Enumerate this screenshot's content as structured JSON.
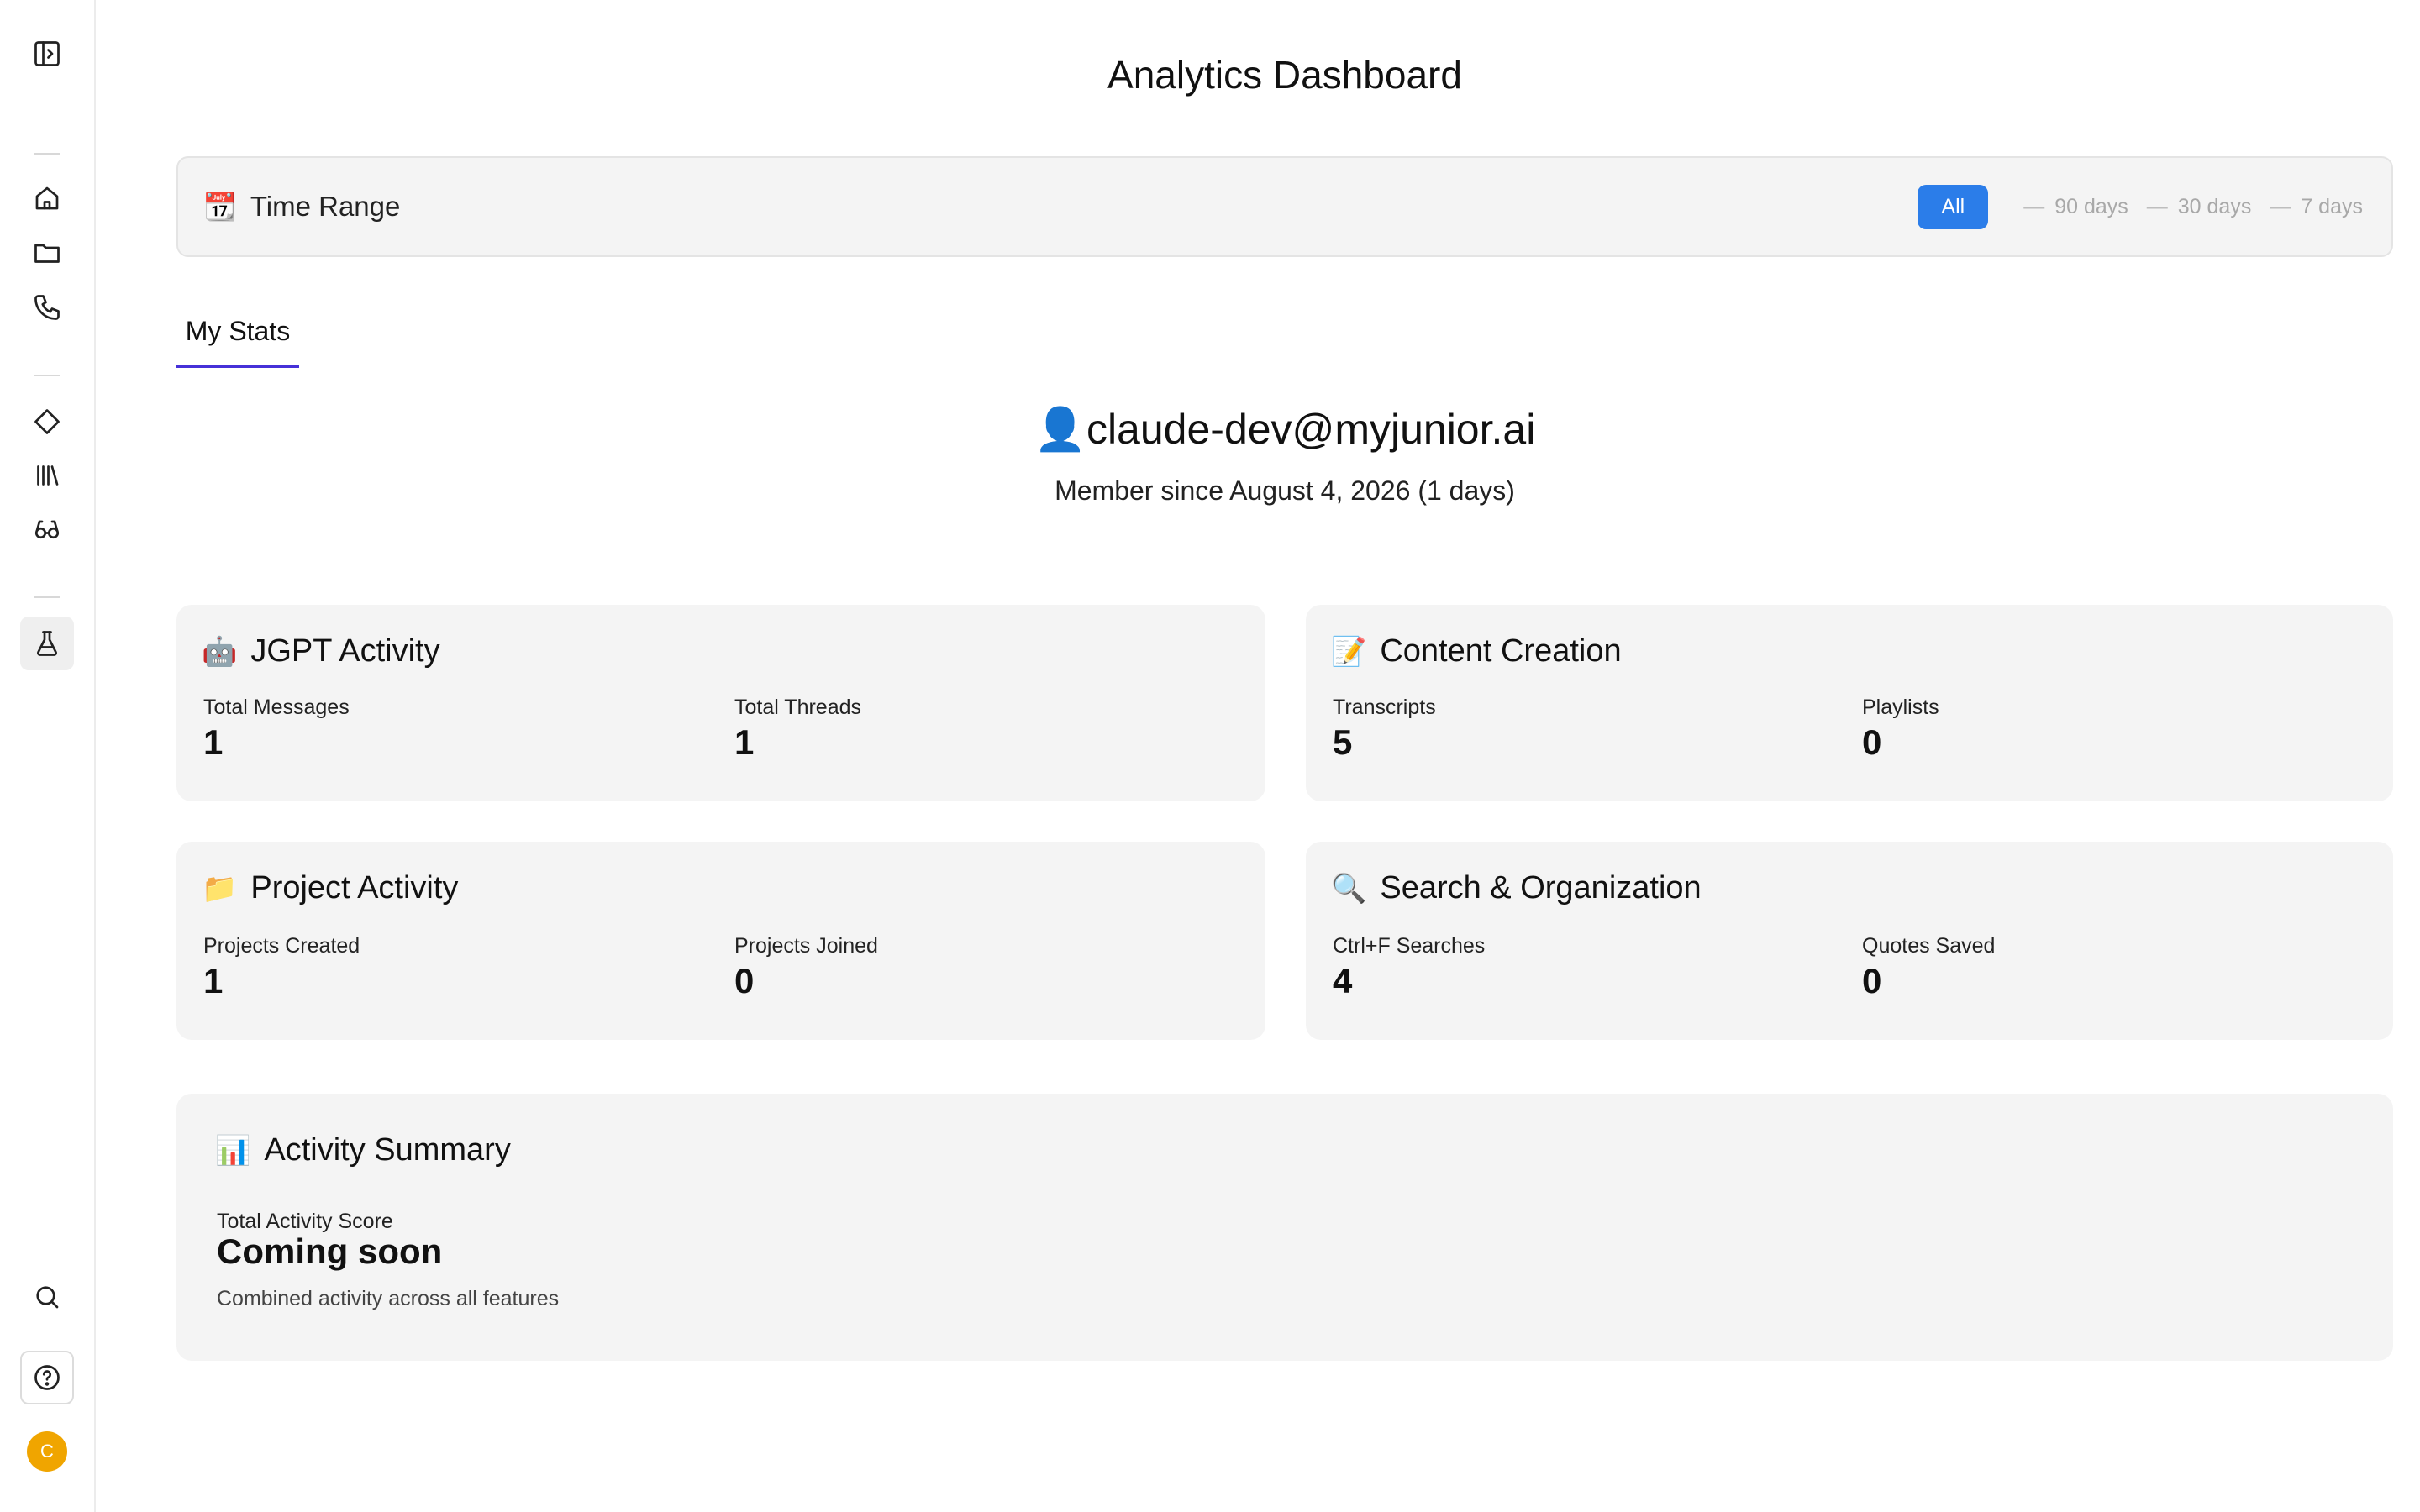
{
  "sidebar": {
    "items": [
      {
        "name": "toggle-sidebar-icon"
      },
      {
        "name": "home-icon"
      },
      {
        "name": "folder-icon"
      },
      {
        "name": "phone-icon"
      },
      {
        "name": "diamond-icon"
      },
      {
        "name": "library-icon"
      },
      {
        "name": "glasses-icon"
      },
      {
        "name": "flask-icon",
        "active": true
      },
      {
        "name": "search-icon"
      },
      {
        "name": "help-icon"
      }
    ],
    "avatar_initial": "C"
  },
  "page": {
    "title": "Analytics Dashboard"
  },
  "time_range": {
    "icon": "📆",
    "label": "Time Range",
    "selected": "All",
    "options": [
      "90 days",
      "30 days",
      "7 days"
    ],
    "accent": "#2b7de9"
  },
  "tabs": [
    {
      "label": "My Stats",
      "active": true
    }
  ],
  "user": {
    "icon": "👤",
    "email": "claude-dev@myjunior.ai",
    "member_since": "Member since August 4, 2026 (1 days)"
  },
  "cards": {
    "jgpt": {
      "icon": "🤖",
      "title": "JGPT Activity",
      "stats": [
        {
          "label": "Total Messages",
          "value": "1"
        },
        {
          "label": "Total Threads",
          "value": "1"
        }
      ]
    },
    "content": {
      "icon": "📝",
      "title": "Content Creation",
      "stats": [
        {
          "label": "Transcripts",
          "value": "5"
        },
        {
          "label": "Playlists",
          "value": "0"
        }
      ]
    },
    "project": {
      "icon": "📁",
      "title": "Project Activity",
      "stats": [
        {
          "label": "Projects Created",
          "value": "1"
        },
        {
          "label": "Projects Joined",
          "value": "0"
        }
      ]
    },
    "search": {
      "icon": "🔍",
      "title": "Search & Organization",
      "stats": [
        {
          "label": "Ctrl+F Searches",
          "value": "4"
        },
        {
          "label": "Quotes Saved",
          "value": "0"
        }
      ]
    }
  },
  "summary": {
    "icon": "📊",
    "title": "Activity Summary",
    "label": "Total Activity Score",
    "value": "Coming soon",
    "description": "Combined activity across all features"
  }
}
